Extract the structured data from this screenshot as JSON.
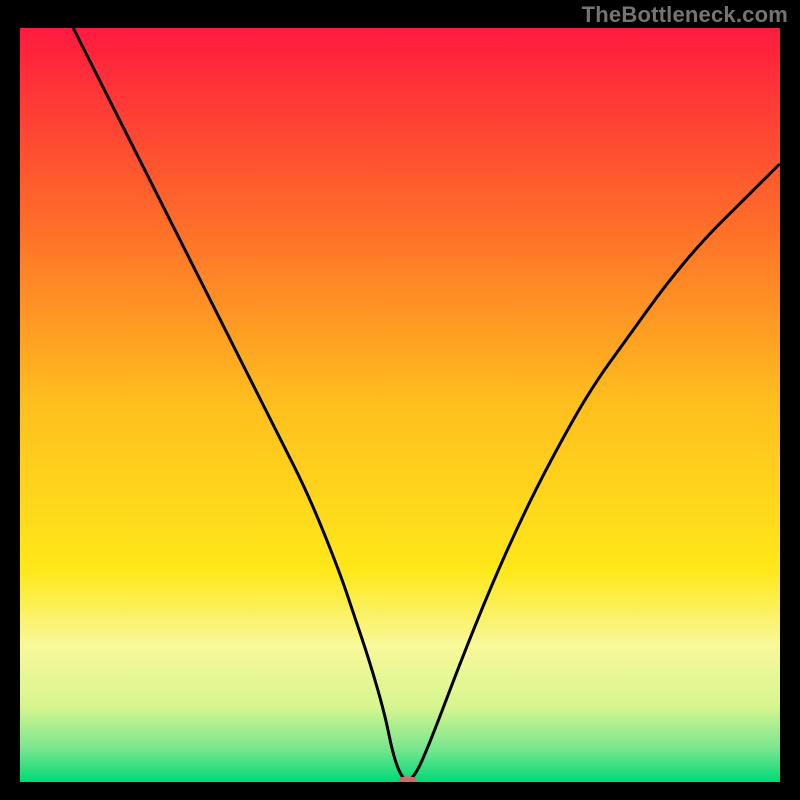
{
  "watermark": "TheBottleneck.com",
  "chart_data": {
    "type": "line",
    "title": "",
    "xlabel": "",
    "ylabel": "",
    "xlim": [
      0,
      100
    ],
    "ylim": [
      0,
      100
    ],
    "grid": false,
    "legend": false,
    "background_gradient_stops": [
      {
        "offset": 0.0,
        "color": "#ff1a3f"
      },
      {
        "offset": 0.25,
        "color": "#ff6a2a"
      },
      {
        "offset": 0.5,
        "color": "#ffbf1e"
      },
      {
        "offset": 0.72,
        "color": "#ffe81a"
      },
      {
        "offset": 0.82,
        "color": "#f8f89a"
      },
      {
        "offset": 0.9,
        "color": "#d7f58f"
      },
      {
        "offset": 0.955,
        "color": "#7be68f"
      },
      {
        "offset": 1.0,
        "color": "#00d977"
      }
    ],
    "series": [
      {
        "name": "bottleneck-curve",
        "color": "#000000",
        "x": [
          7,
          10,
          14,
          18,
          22,
          26,
          30,
          34,
          38,
          42,
          44,
          46,
          48,
          49,
          50,
          51,
          52,
          53,
          55,
          58,
          62,
          66,
          70,
          75,
          80,
          85,
          90,
          95,
          100
        ],
        "y": [
          100,
          94,
          86,
          78,
          70,
          62,
          54,
          46,
          38,
          28,
          22,
          16,
          9,
          4,
          1,
          0,
          1,
          3,
          8,
          16,
          26,
          35,
          43,
          52,
          59,
          66,
          72,
          77,
          82
        ]
      }
    ],
    "marker": {
      "x": 51,
      "y": 0,
      "color": "#d06a6a",
      "width_pct": 2.4,
      "height_pct": 1.4
    }
  }
}
